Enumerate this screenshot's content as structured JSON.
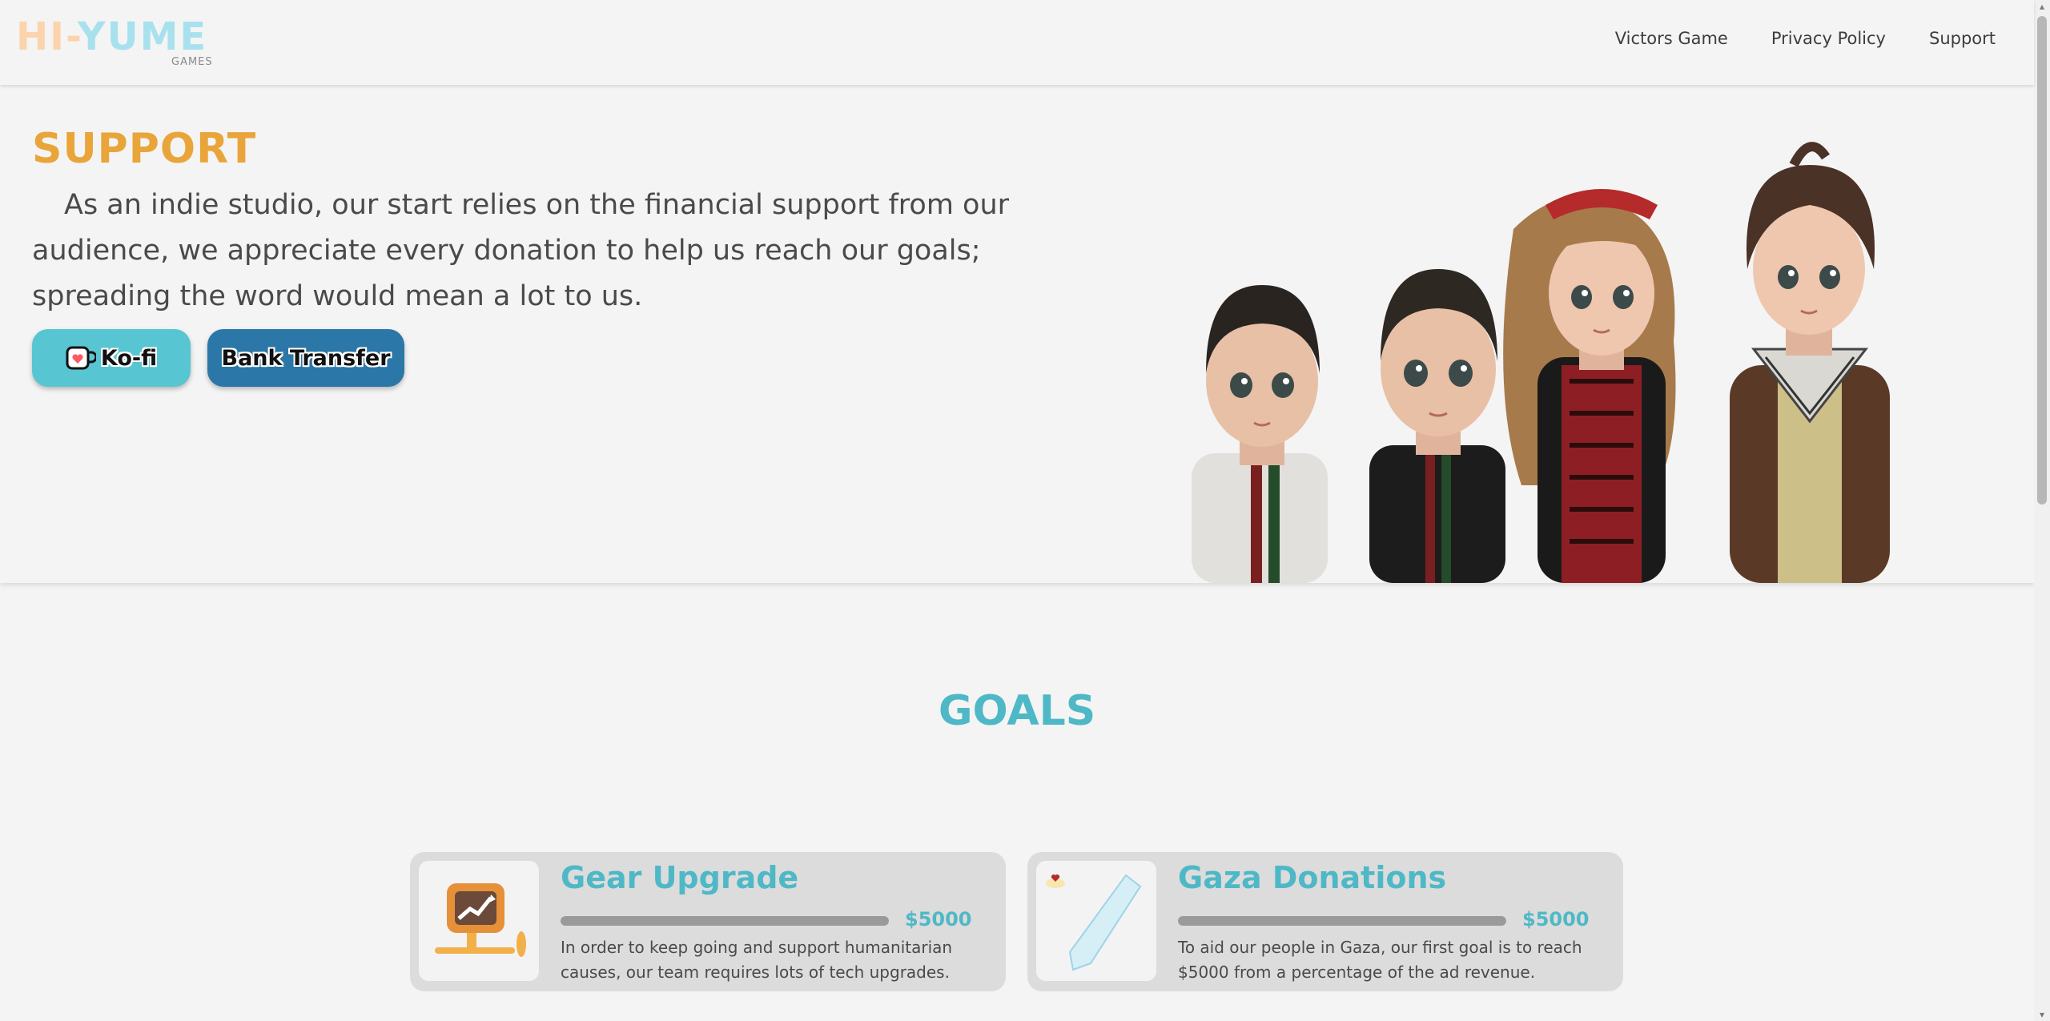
{
  "header": {
    "logo": {
      "part1": "HI",
      "dash": "-",
      "part2": "YUME",
      "sub": "GAMES"
    },
    "nav": [
      {
        "label": "Victors Game"
      },
      {
        "label": "Privacy Policy"
      },
      {
        "label": "Support"
      }
    ]
  },
  "support": {
    "title": "SUPPORT",
    "text": "As an indie studio, our start relies on the financial support from our audience, we appreciate every donation to help us reach our goals; spreading the word would mean a lot to us.",
    "buttons": {
      "kofi_label": "Ko-fi",
      "bank_label": "Bank Transfer"
    }
  },
  "goals": {
    "title": "GOALS",
    "items": [
      {
        "title": "Gear Upgrade",
        "amount": "$5000",
        "progress": 1.0,
        "description": "In order to keep going and support humanitarian causes, our team requires lots of tech upgrades.",
        "icon": "gear-upgrade-icon"
      },
      {
        "title": "Gaza Donations",
        "amount": "$5000",
        "progress": 1.0,
        "description": "To aid our people in Gaza, our first goal is to reach $5000 from a percentage of the ad revenue.",
        "icon": "gaza-map-icon"
      }
    ]
  },
  "colors": {
    "accent_orange": "#e9a43a",
    "accent_teal": "#4fb8c6",
    "kofi_button": "#58c5d2",
    "bank_button": "#2b77a8",
    "background": "#f4f4f4"
  }
}
